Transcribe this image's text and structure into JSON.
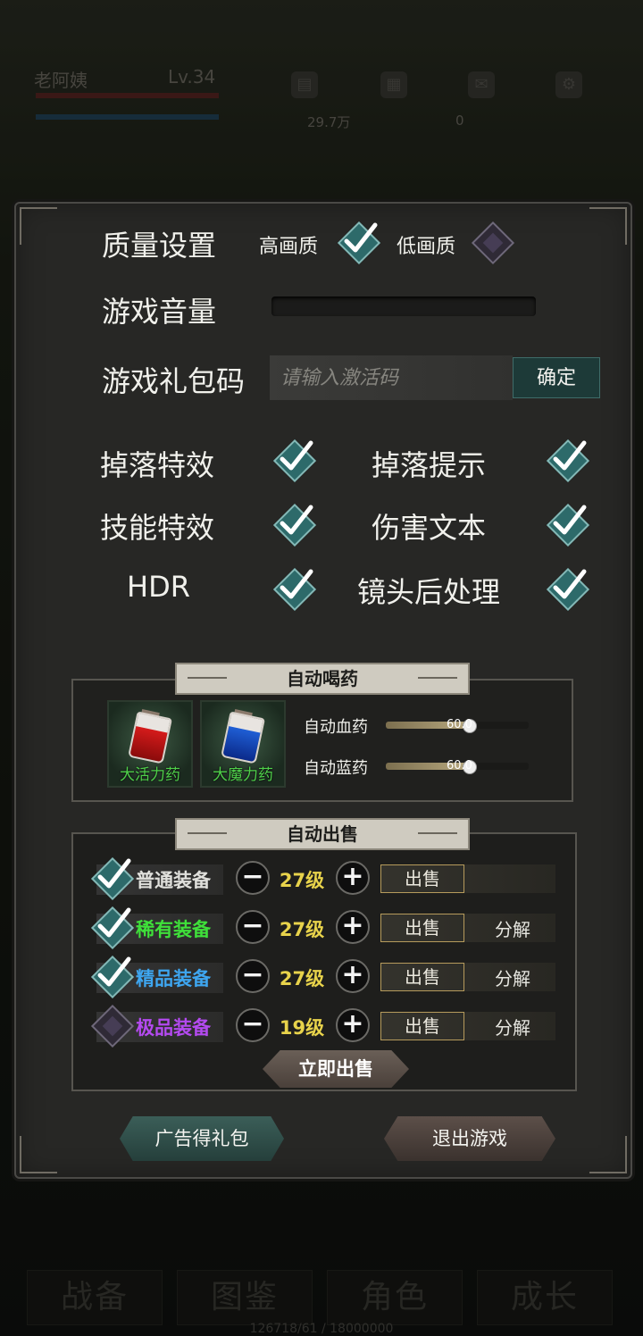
{
  "hud": {
    "player_name": "老阿姨",
    "level": "Lv.34",
    "gold": "29.7万",
    "gems": "0"
  },
  "settings": {
    "quality_label": "质量设置",
    "quality_high": "高画质",
    "quality_low": "低画质",
    "quality_high_checked": true,
    "quality_low_checked": false,
    "volume_label": "游戏音量",
    "gift_code_label": "游戏礼包码",
    "gift_code_placeholder": "请输入激活码",
    "confirm_label": "确定",
    "toggles": {
      "drop_effect": "掉落特效",
      "drop_hint": "掉落提示",
      "skill_effect": "技能特效",
      "damage_text": "伤害文本",
      "hdr": "HDR",
      "post_process": "镜头后处理"
    }
  },
  "auto_potion": {
    "title": "自动喝药",
    "hp_potion_name": "大活力药",
    "mp_potion_name": "大魔力药",
    "hp_label": "自动血药",
    "mp_label": "自动蓝药",
    "hp_value": "60.0",
    "mp_value": "60.0",
    "hp_fraction": 0.6,
    "mp_fraction": 0.6
  },
  "auto_sell": {
    "title": "自动出售",
    "sell_label": "出售",
    "decompose_label": "分解",
    "rows": [
      {
        "name": "普通装备",
        "level": "27级",
        "color": "#e0e0dc",
        "checked": true,
        "decompose": ""
      },
      {
        "name": "稀有装备",
        "level": "27级",
        "color": "#3fe03a",
        "checked": true,
        "decompose": "分解"
      },
      {
        "name": "精品装备",
        "level": "27级",
        "color": "#3ea6f0",
        "checked": true,
        "decompose": "分解"
      },
      {
        "name": "极品装备",
        "level": "19级",
        "color": "#b44af0",
        "checked": false,
        "decompose": "分解"
      }
    ],
    "sell_now_label": "立即出售"
  },
  "footer": {
    "ad_label": "广告得礼包",
    "exit_label": "退出游戏"
  },
  "bottom_nav": {
    "items": [
      "战备",
      "图鉴",
      "角色",
      "成长"
    ],
    "exp": "126718/61 / 18000000"
  }
}
